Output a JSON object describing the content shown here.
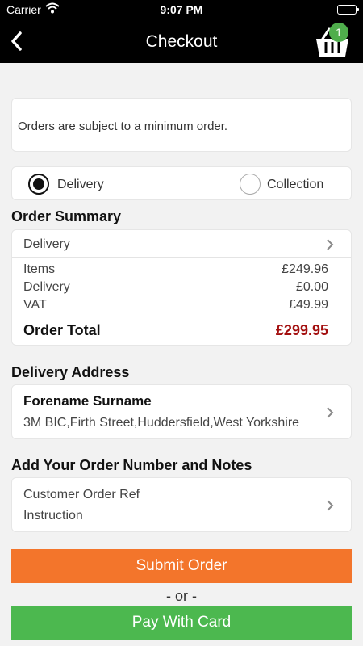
{
  "status_bar": {
    "carrier": "Carrier",
    "time": "9:07 PM"
  },
  "nav": {
    "title": "Checkout",
    "basket_count": "1"
  },
  "notice": {
    "text": "Orders are subject to a minimum order."
  },
  "fulfilment": {
    "options": [
      {
        "label": "Delivery",
        "selected": true
      },
      {
        "label": "Collection",
        "selected": false
      }
    ]
  },
  "order_summary": {
    "title": "Order Summary",
    "method_row": "Delivery",
    "lines": [
      {
        "label": "Items",
        "value": "£249.96"
      },
      {
        "label": "Delivery",
        "value": "£0.00"
      },
      {
        "label": "VAT",
        "value": "£49.99"
      }
    ],
    "total_label": "Order Total",
    "total_value": "£299.95"
  },
  "delivery_address": {
    "title": "Delivery Address",
    "name": "Forename Surname",
    "address": "3M BIC,Firth Street,Huddersfield,West Yorkshire"
  },
  "order_notes": {
    "title": "Add Your Order Number and Notes",
    "ref_placeholder": "Customer Order Ref",
    "instruction_placeholder": "Instruction"
  },
  "actions": {
    "submit_label": "Submit Order",
    "or_label": "- or -",
    "pay_label": "Pay With Card"
  },
  "colors": {
    "nav_bg": "#000000",
    "badge": "#4fae4c",
    "total_text": "#a30f0f",
    "submit_button": "#f3752b",
    "pay_button": "#4cb84f"
  }
}
